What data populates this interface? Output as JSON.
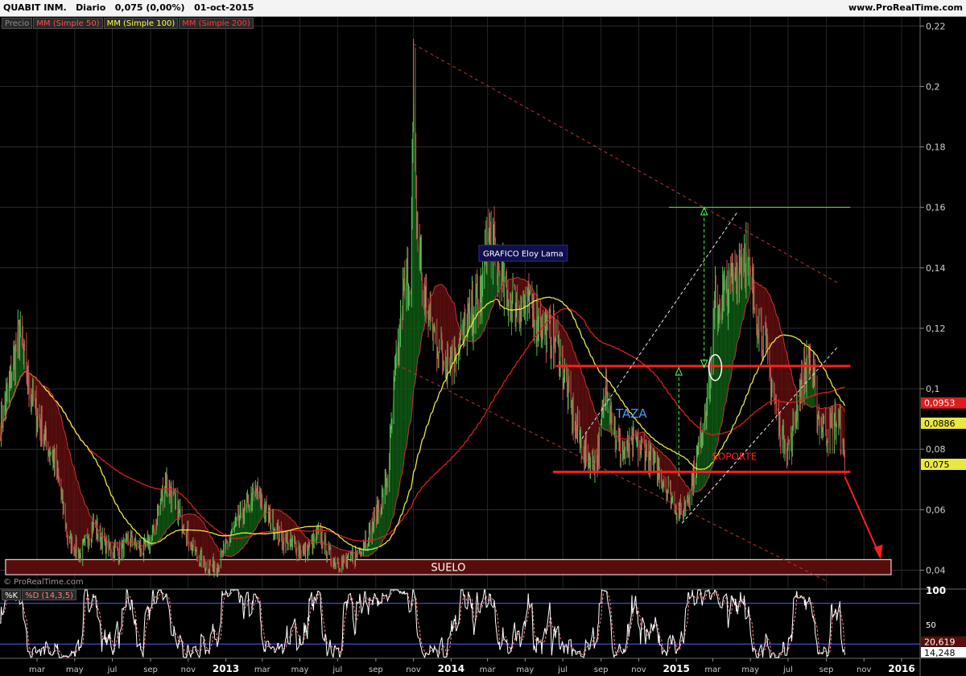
{
  "header": {
    "title": "QUABIT INM.   Diario   0,075 (0,00%)   01-oct-2015",
    "site": "www.ProRealTime.com"
  },
  "legend": {
    "price": "Precio",
    "ma50": "MM (Simple 50)",
    "ma100": "MM (Simple 100)",
    "ma200": "MM (Simple 200)"
  },
  "stoch_legend": {
    "k": "%K",
    "d": "%D (14,3,5)"
  },
  "copyright": "© ProRealTime.com",
  "colors": {
    "price_up": "#55c055",
    "price_down": "#c05050",
    "ma50": "#c83232",
    "ma100": "#e8e840",
    "ma200": "#dc1e1e",
    "fill_up": "#0f5a14",
    "fill_down": "#5f0f0f",
    "annotation_red": "#ff1e1e",
    "annotation_green": "#44ff44",
    "stoch_k": "#ffffff",
    "stoch_d": "#ff8080",
    "stoch_bands": "#5a5aff"
  },
  "chart_data": [
    {
      "type": "line",
      "title": "",
      "y_axis": {
        "range": [
          0.034,
          0.223
        ],
        "ticks": [
          "0,22",
          "0,2",
          "0,18",
          "0,16",
          "0,14",
          "0,12",
          "0,1",
          "0,08",
          "0,06",
          "0,04"
        ],
        "tick_values": [
          0.22,
          0.2,
          0.18,
          0.16,
          0.14,
          0.12,
          0.1,
          0.08,
          0.06,
          0.04
        ],
        "position": "right",
        "grid": true
      },
      "x_axis": {
        "range": [
          "2012-01-01",
          "2016-01-31"
        ],
        "ticks": [
          "mar",
          "may",
          "jul",
          "sep",
          "nov",
          "2013",
          "mar",
          "may",
          "jul",
          "sep",
          "nov",
          "2014",
          "mar",
          "may",
          "jul",
          "sep",
          "nov",
          "2015",
          "mar",
          "may",
          "jul",
          "sep",
          "nov",
          "2016"
        ],
        "tick_dates": [
          "2012-03-01",
          "2012-05-01",
          "2012-07-01",
          "2012-09-01",
          "2012-11-01",
          "2013-01-01",
          "2013-03-01",
          "2013-05-01",
          "2013-07-01",
          "2013-09-01",
          "2013-11-01",
          "2014-01-01",
          "2014-03-01",
          "2014-05-01",
          "2014-07-01",
          "2014-09-01",
          "2014-11-01",
          "2015-01-01",
          "2015-03-01",
          "2015-05-01",
          "2015-07-01",
          "2015-09-01",
          "2015-11-01",
          "2016-01-01"
        ],
        "grid": true
      },
      "price_keypoints": [
        [
          "2012-01-02",
          0.088
        ],
        [
          "2012-01-15",
          0.1
        ],
        [
          "2012-02-01",
          0.118
        ],
        [
          "2012-02-20",
          0.098
        ],
        [
          "2012-03-10",
          0.085
        ],
        [
          "2012-04-01",
          0.075
        ],
        [
          "2012-04-20",
          0.05
        ],
        [
          "2012-05-10",
          0.045
        ],
        [
          "2012-06-01",
          0.055
        ],
        [
          "2012-06-20",
          0.048
        ],
        [
          "2012-07-10",
          0.046
        ],
        [
          "2012-08-01",
          0.05
        ],
        [
          "2012-08-20",
          0.046
        ],
        [
          "2012-09-05",
          0.052
        ],
        [
          "2012-09-25",
          0.07
        ],
        [
          "2012-10-10",
          0.062
        ],
        [
          "2012-10-25",
          0.055
        ],
        [
          "2012-11-10",
          0.046
        ],
        [
          "2012-12-01",
          0.041
        ],
        [
          "2012-12-20",
          0.042
        ],
        [
          "2013-01-10",
          0.052
        ],
        [
          "2013-02-01",
          0.06
        ],
        [
          "2013-02-20",
          0.066
        ],
        [
          "2013-03-10",
          0.058
        ],
        [
          "2013-04-01",
          0.05
        ],
        [
          "2013-04-20",
          0.048
        ],
        [
          "2013-05-10",
          0.046
        ],
        [
          "2013-06-01",
          0.052
        ],
        [
          "2013-06-20",
          0.044
        ],
        [
          "2013-07-10",
          0.042
        ],
        [
          "2013-08-01",
          0.045
        ],
        [
          "2013-08-20",
          0.052
        ],
        [
          "2013-09-05",
          0.06
        ],
        [
          "2013-09-20",
          0.07
        ],
        [
          "2013-10-01",
          0.1
        ],
        [
          "2013-10-15",
          0.13
        ],
        [
          "2013-10-28",
          0.14
        ],
        [
          "2013-11-01",
          0.2
        ],
        [
          "2013-11-05",
          0.16
        ],
        [
          "2013-11-15",
          0.135
        ],
        [
          "2013-12-01",
          0.12
        ],
        [
          "2013-12-20",
          0.11
        ],
        [
          "2014-01-05",
          0.112
        ],
        [
          "2014-01-20",
          0.118
        ],
        [
          "2014-02-05",
          0.125
        ],
        [
          "2014-02-20",
          0.132
        ],
        [
          "2014-03-01",
          0.152
        ],
        [
          "2014-03-15",
          0.142
        ],
        [
          "2014-04-01",
          0.13
        ],
        [
          "2014-04-20",
          0.128
        ],
        [
          "2014-05-10",
          0.126
        ],
        [
          "2014-06-01",
          0.12
        ],
        [
          "2014-06-20",
          0.115
        ],
        [
          "2014-07-05",
          0.103
        ],
        [
          "2014-07-20",
          0.088
        ],
        [
          "2014-08-05",
          0.078
        ],
        [
          "2014-08-25",
          0.075
        ],
        [
          "2014-09-10",
          0.103
        ],
        [
          "2014-09-25",
          0.083
        ],
        [
          "2014-10-10",
          0.078
        ],
        [
          "2014-10-25",
          0.082
        ],
        [
          "2014-11-10",
          0.08
        ],
        [
          "2014-11-25",
          0.075
        ],
        [
          "2014-12-10",
          0.07
        ],
        [
          "2014-12-25",
          0.063
        ],
        [
          "2015-01-10",
          0.058
        ],
        [
          "2015-01-25",
          0.068
        ],
        [
          "2015-02-10",
          0.085
        ],
        [
          "2015-02-25",
          0.105
        ],
        [
          "2015-03-05",
          0.128
        ],
        [
          "2015-03-20",
          0.13
        ],
        [
          "2015-04-05",
          0.138
        ],
        [
          "2015-04-20",
          0.148
        ],
        [
          "2015-05-05",
          0.13
        ],
        [
          "2015-05-20",
          0.12
        ],
        [
          "2015-06-05",
          0.1
        ],
        [
          "2015-06-20",
          0.085
        ],
        [
          "2015-07-05",
          0.08
        ],
        [
          "2015-07-20",
          0.1
        ],
        [
          "2015-08-05",
          0.11
        ],
        [
          "2015-08-20",
          0.09
        ],
        [
          "2015-09-05",
          0.085
        ],
        [
          "2015-09-20",
          0.09
        ],
        [
          "2015-10-01",
          0.075
        ]
      ],
      "last_values": {
        "price": "0,075",
        "ma100": "0,0886",
        "ma200": "0,0953"
      },
      "annotations": {
        "suelo": {
          "label": "SUELO",
          "range": [
            0.0385,
            0.0435
          ],
          "from": "2012-01-10",
          "to": "2015-12-15"
        },
        "soporte": {
          "label": "SOPORTE",
          "value": 0.0725,
          "from": "2014-06-15",
          "to": "2015-10-10"
        },
        "resistance": {
          "value": 0.1075,
          "from": "2014-06-20",
          "to": "2015-10-10"
        },
        "target": {
          "value": 0.16,
          "from": "2014-12-20",
          "to": "2015-10-10"
        },
        "taza": "TAZA",
        "grafico": "GRAFICO Eloy Lama"
      }
    },
    {
      "type": "line",
      "title": "",
      "y_axis": {
        "range": [
          0,
          100
        ],
        "ticks": [
          "100",
          "50"
        ],
        "tick_values": [
          100,
          50
        ],
        "bands": [
          20,
          80
        ]
      },
      "last_values": {
        "k": "20,619",
        "d": "14,248"
      }
    }
  ]
}
